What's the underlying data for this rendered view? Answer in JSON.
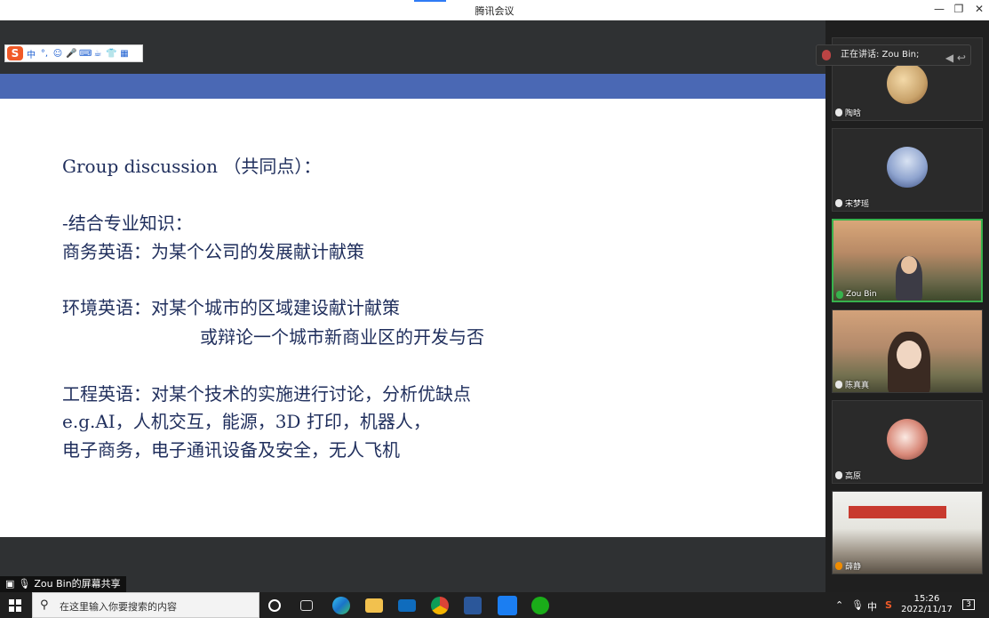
{
  "window": {
    "title": "腾讯会议",
    "minimize": "—",
    "maximize": "❐",
    "close": "✕"
  },
  "ime": {
    "logo": "S",
    "lang": "中",
    "glyphs": [
      "°,",
      "☺",
      "🎤",
      "⌨",
      "☕",
      "👕",
      "▦"
    ]
  },
  "speaking": {
    "label": "正在讲话: Zou Bin;",
    "nav": "◀ ↩"
  },
  "slide": {
    "lines": [
      "Group discussion （共同点）：",
      "-结合专业知识：",
      "商务英语：为某个公司的发展献计献策",
      "环境英语：对某个城市的区域建设献计献策",
      "或辩论一个城市新商业区的开发与否",
      "工程英语：对某个技术的实施进行讨论，分析优缺点",
      "e.g.AI，人机交互，能源，3D 打印，机器人，",
      "电子商务，电子通讯设备及安全，无人飞机"
    ]
  },
  "share_label": "Zou Bin的屏幕共享",
  "participants": [
    {
      "name": "陶晗",
      "kind": "avatar",
      "color": "#c9a36b"
    },
    {
      "name": "宋梦瑶",
      "kind": "avatar",
      "color": "#8fa4cf"
    },
    {
      "name": "Zou Bin",
      "kind": "camera",
      "active": true
    },
    {
      "name": "陈真真",
      "kind": "camera"
    },
    {
      "name": "高原",
      "kind": "avatar",
      "color": "#d98a7a"
    },
    {
      "name": "薛静",
      "kind": "room"
    }
  ],
  "taskbar": {
    "search_placeholder": "在这里输入你要搜索的内容",
    "tray": {
      "ime": "中",
      "sogou": "S",
      "notifications": "3"
    },
    "time": "15:26",
    "date": "2022/11/17"
  }
}
